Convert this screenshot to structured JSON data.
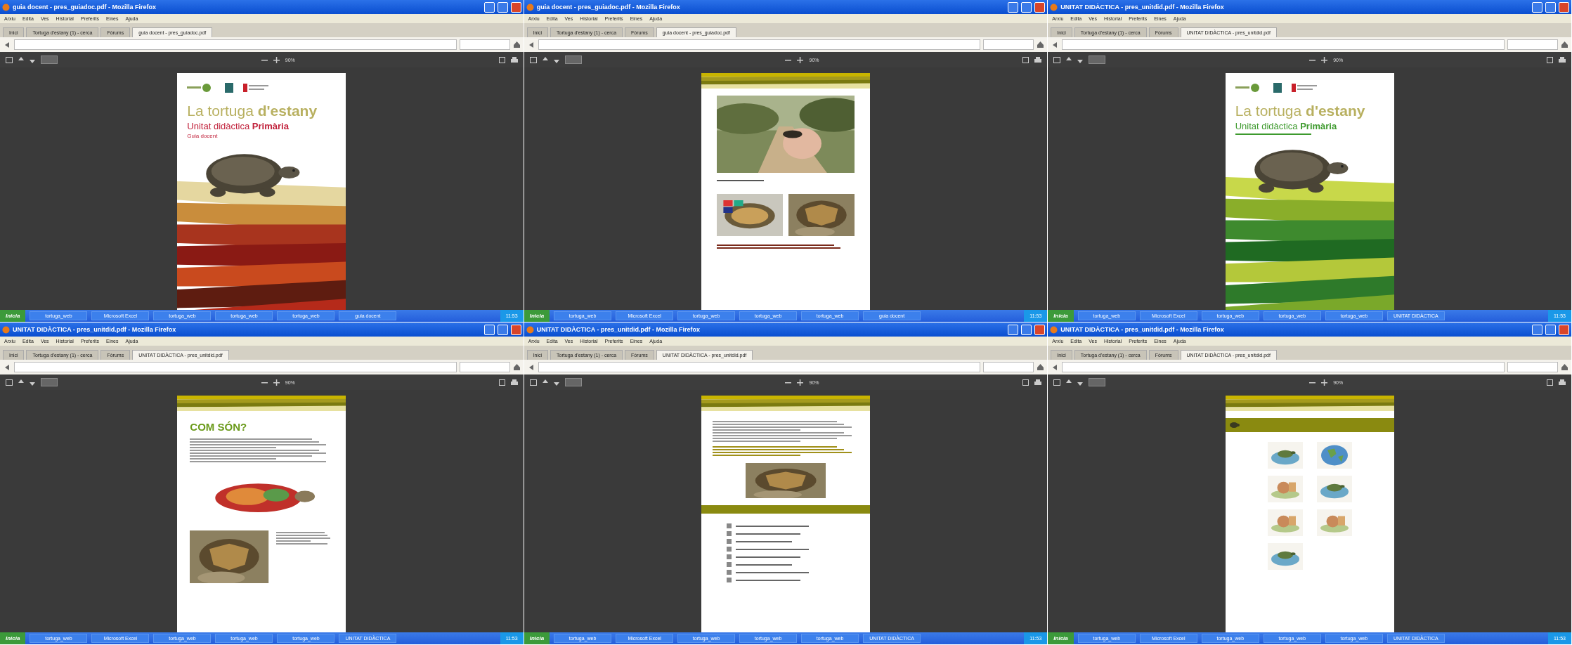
{
  "windows": [
    {
      "title": "guia docent - pres_guiadoc.pdf - Mozilla Firefox",
      "menu": [
        "Arxiu",
        "Edita",
        "Ves",
        "Historial",
        "Preferits",
        "Eines",
        "Ajuda"
      ],
      "tabs": [
        {
          "label": "Inici",
          "selected": false
        },
        {
          "label": "Tortuga d'estany (1) - cerca",
          "selected": false
        },
        {
          "label": "Fòrums",
          "selected": false
        },
        {
          "label": "guia docent - pres_guiadoc.pdf",
          "selected": true
        }
      ],
      "zoom": "90%",
      "page": {
        "kind": "cover",
        "color": "#c0203a",
        "title": "La tortuga **d'estany**",
        "subtitle": "Unitat didàctica **Primària**",
        "note": "Guia docent"
      },
      "taskbar": {
        "start": "Inicia",
        "items": [
          "tortuga_web",
          "Microsoft Excel",
          "tortuga_web",
          "tortuga_web",
          "tortuga_web",
          "guia docent"
        ],
        "clock": "11:53"
      }
    },
    {
      "title": "guia docent - pres_guiadoc.pdf - Mozilla Firefox",
      "menu": [
        "Arxiu",
        "Edita",
        "Ves",
        "Historial",
        "Preferits",
        "Eines",
        "Ajuda"
      ],
      "tabs": [
        {
          "label": "Inici",
          "selected": false
        },
        {
          "label": "Tortuga d'estany (1) - cerca",
          "selected": false
        },
        {
          "label": "Fòrums",
          "selected": false
        },
        {
          "label": "guia docent - pres_guiadoc.pdf",
          "selected": true
        }
      ],
      "zoom": "90%",
      "page": {
        "kind": "photos"
      },
      "taskbar": {
        "start": "Inicia",
        "items": [
          "tortuga_web",
          "Microsoft Excel",
          "tortuga_web",
          "tortuga_web",
          "tortuga_web",
          "guia docent"
        ],
        "clock": "11:53"
      }
    },
    {
      "title": "UNITAT DIDÀCTICA - pres_unitdid.pdf - Mozilla Firefox",
      "menu": [
        "Arxiu",
        "Edita",
        "Ves",
        "Historial",
        "Preferits",
        "Eines",
        "Ajuda"
      ],
      "tabs": [
        {
          "label": "Inici",
          "selected": false
        },
        {
          "label": "Tortuga d'estany (1) - cerca",
          "selected": false
        },
        {
          "label": "Fòrums",
          "selected": false
        },
        {
          "label": "UNITAT DIDÀCTICA - pres_unitdid.pdf",
          "selected": true
        }
      ],
      "zoom": "90%",
      "page": {
        "kind": "cover",
        "color": "#3e9a2e",
        "title": "La tortuga **d'estany**",
        "subtitle": "Unitat didàctica **Primària**"
      },
      "taskbar": {
        "start": "Inicia",
        "items": [
          "tortuga_web",
          "Microsoft Excel",
          "tortuga_web",
          "tortuga_web",
          "tortuga_web",
          "UNITAT DIDÀCTICA"
        ],
        "clock": "11:53"
      }
    },
    {
      "title": "UNITAT DIDÀCTICA - pres_unitdid.pdf - Mozilla Firefox",
      "menu": [
        "Arxiu",
        "Edita",
        "Ves",
        "Historial",
        "Preferits",
        "Eines",
        "Ajuda"
      ],
      "tabs": [
        {
          "label": "Inici",
          "selected": false
        },
        {
          "label": "Tortuga d'estany (1) - cerca",
          "selected": false
        },
        {
          "label": "Fòrums",
          "selected": false
        },
        {
          "label": "UNITAT DIDÀCTICA - pres_unitdid.pdf",
          "selected": true
        }
      ],
      "zoom": "90%",
      "page": {
        "kind": "anatomy",
        "heading": "COM SÓN?"
      },
      "taskbar": {
        "start": "Inicia",
        "items": [
          "tortuga_web",
          "Microsoft Excel",
          "tortuga_web",
          "tortuga_web",
          "tortuga_web",
          "UNITAT DIDÀCTICA"
        ],
        "clock": "11:53"
      }
    },
    {
      "title": "UNITAT DIDÀCTICA - pres_unitdid.pdf - Mozilla Firefox",
      "menu": [
        "Arxiu",
        "Edita",
        "Ves",
        "Historial",
        "Preferits",
        "Eines",
        "Ajuda"
      ],
      "tabs": [
        {
          "label": "Inici",
          "selected": false
        },
        {
          "label": "Tortuga d'estany (1) - cerca",
          "selected": false
        },
        {
          "label": "Fòrums",
          "selected": false
        },
        {
          "label": "UNITAT DIDÀCTICA - pres_unitdid.pdf",
          "selected": true
        }
      ],
      "zoom": "90%",
      "page": {
        "kind": "checklist"
      },
      "taskbar": {
        "start": "Inicia",
        "items": [
          "tortuga_web",
          "Microsoft Excel",
          "tortuga_web",
          "tortuga_web",
          "tortuga_web",
          "UNITAT DIDÀCTICA"
        ],
        "clock": "11:53"
      }
    },
    {
      "title": "UNITAT DIDÀCTICA - pres_unitdid.pdf - Mozilla Firefox",
      "menu": [
        "Arxiu",
        "Edita",
        "Ves",
        "Historial",
        "Preferits",
        "Eines",
        "Ajuda"
      ],
      "tabs": [
        {
          "label": "Inici",
          "selected": false
        },
        {
          "label": "Tortuga d'estany (1) - cerca",
          "selected": false
        },
        {
          "label": "Fòrums",
          "selected": false
        },
        {
          "label": "UNITAT DIDÀCTICA - pres_unitdid.pdf",
          "selected": true
        }
      ],
      "zoom": "90%",
      "page": {
        "kind": "illustrations"
      },
      "taskbar": {
        "start": "Inicia",
        "items": [
          "tortuga_web",
          "Microsoft Excel",
          "tortuga_web",
          "tortuga_web",
          "tortuga_web",
          "UNITAT DIDÀCTICA"
        ],
        "clock": "11:53"
      }
    }
  ]
}
